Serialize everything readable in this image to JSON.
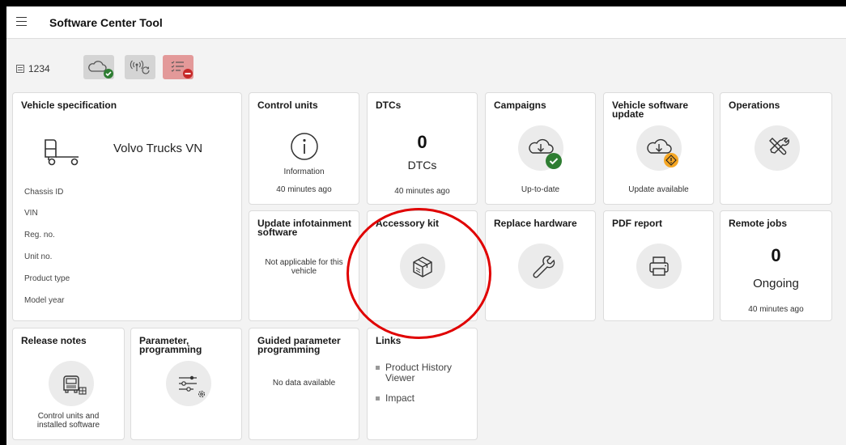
{
  "app": {
    "title": "Software Center Tool"
  },
  "status": {
    "chassis_number": "1234"
  },
  "cards": {
    "vehicle_spec": {
      "title": "Vehicle specification",
      "vehicle_name": "Volvo Trucks VN",
      "fields": [
        "Chassis ID",
        "VIN",
        "Reg. no.",
        "Unit no.",
        "Product type",
        "Model year"
      ]
    },
    "control_units": {
      "title": "Control units",
      "status": "Information",
      "time": "40 minutes ago"
    },
    "dtcs": {
      "title": "DTCs",
      "count": "0",
      "unit": "DTCs",
      "time": "40 minutes ago"
    },
    "campaigns": {
      "title": "Campaigns",
      "status": "Up-to-date"
    },
    "vehicle_software_update": {
      "title_line1": "Vehicle software",
      "title_line2": "update",
      "status": "Update available"
    },
    "operations": {
      "title": "Operations"
    },
    "update_infotainment": {
      "title_line1": "Update infotainment",
      "title_line2": "software",
      "status_line1": "Not applicable for this",
      "status_line2": "vehicle"
    },
    "accessory_kit": {
      "title": "Accessory kit"
    },
    "replace_hardware": {
      "title": "Replace hardware"
    },
    "pdf_report": {
      "title": "PDF report"
    },
    "remote_jobs": {
      "title": "Remote jobs",
      "count": "0",
      "state": "Ongoing",
      "time": "40 minutes ago"
    },
    "release_notes": {
      "title": "Release notes",
      "caption_line1": "Control units and",
      "caption_line2": "installed software"
    },
    "parameter_programming": {
      "title_line1": "Parameter,",
      "title_line2": "programming"
    },
    "guided_parameter": {
      "title_line1": "Guided parameter",
      "title_line2": "programming",
      "status": "No data available"
    },
    "links": {
      "title": "Links",
      "items": [
        "Product History",
        "Viewer",
        "Impact"
      ]
    }
  },
  "colors": {
    "success": "#2e7d32",
    "warning": "#f5a623",
    "error": "#c62828",
    "annotation": "#e00000"
  },
  "icons": [
    "menu-icon",
    "chassis-icon",
    "cloud-icon",
    "signal-icon",
    "checklist-icon",
    "truck-icon",
    "info-icon",
    "cloud-check-icon",
    "cloud-download-icon",
    "tools-icon",
    "package-icon",
    "wrench-icon",
    "printer-icon",
    "truck-front-icon",
    "sliders-icon"
  ]
}
